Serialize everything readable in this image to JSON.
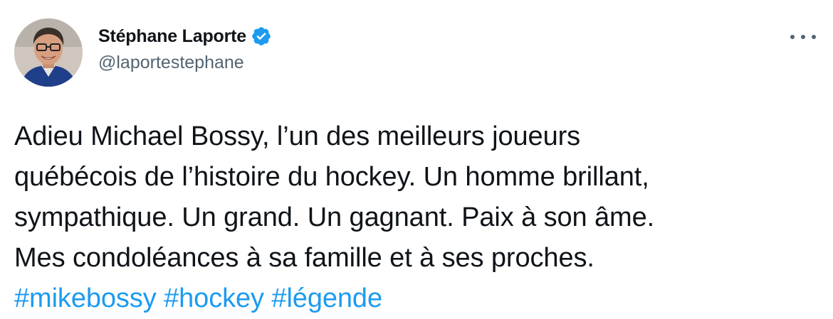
{
  "author": {
    "display_name": "Stéphane Laporte",
    "handle": "@laportestephane",
    "verified": true,
    "avatar_icon": "profile-photo"
  },
  "tweet": {
    "lines": [
      "Adieu Michael Bossy, l’un des meilleurs joueurs",
      "québécois de l’histoire du hockey. Un homme brillant,",
      "sympathique. Un grand. Un gagnant. Paix à son âme.",
      "Mes condoléances à sa famille et à ses proches."
    ],
    "hashtags": [
      "#mikebossy",
      "#hockey",
      "#légende"
    ]
  },
  "menu": {
    "icon": "more-horizontal-icon"
  },
  "colors": {
    "text": "#0f1419",
    "secondary": "#536471",
    "link": "#1d9bf0",
    "verified": "#1d9bf0"
  }
}
